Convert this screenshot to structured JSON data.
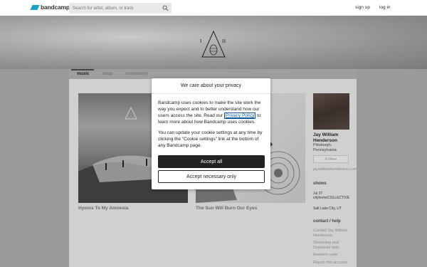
{
  "header": {
    "logo_text": "bandcamp",
    "search_placeholder": "Search for artist, album, or track",
    "signup_label": "sign up",
    "login_label": "log in"
  },
  "tabs": [
    {
      "label": "music",
      "active": true
    },
    {
      "label": "shop",
      "active": false
    },
    {
      "label": "community",
      "active": false
    }
  ],
  "albums": [
    {
      "title": "Hymns To My Amnesia"
    },
    {
      "title": "The Sun Will Burn Our Eyes"
    }
  ],
  "artist": {
    "name": "Jay William Henderson",
    "location": "Pittsburgh, Pennsylvania",
    "follow_label": "Follow",
    "website": "jaywilliamhenderson.com"
  },
  "shows": {
    "heading": "shows",
    "date": "Jul 27",
    "venue": "cityhomeCOLLECTIVE",
    "city": "Salt Lake City, UT"
  },
  "contact": {
    "heading": "contact / help",
    "links": [
      "Contact Jay William Henderson",
      "Streaming and Download help",
      "Redeem code",
      "Report this account"
    ]
  },
  "cookie_modal": {
    "title": "We care about your privacy",
    "para1_before": "Bandcamp uses cookies to make the site work the way you expect and to better understand how our users access the site. Read our ",
    "privacy_link": "Privacy Policy",
    "para1_after": " to learn more about how Bandcamp uses cookies.",
    "para2": "You can update your cookie settings at any time by clicking the “Cookie settings” link at the bottom of any Bandcamp page.",
    "accept_all_label": "Accept all",
    "accept_necessary_label": "Accept necessary only"
  },
  "colors": {
    "brand": "#1da0c3",
    "overlay": "#9a9a9a",
    "accept_button": "#222222",
    "link": "#0b57a4"
  },
  "icons": [
    "bandcamp-logo-icon",
    "search-icon",
    "pinecone-emblem-icon"
  ]
}
